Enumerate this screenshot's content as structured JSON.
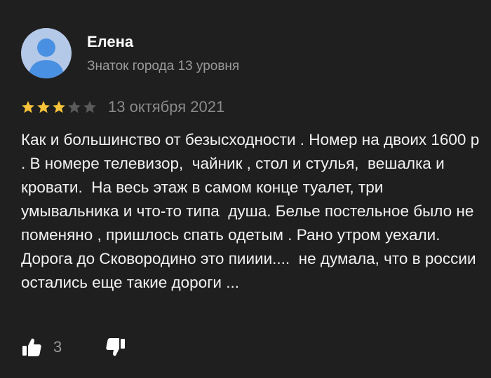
{
  "author": {
    "name": "Елена",
    "level": "Знаток города 13 уровня",
    "avatar_icon": "user-avatar-icon"
  },
  "rating": {
    "value": 3,
    "max": 5,
    "filled_color": "#f7c33b",
    "empty_color": "#5a5a5a"
  },
  "review": {
    "date": "13 октября 2021",
    "text": "Как и большинство от безысходности . Номер на двоих 1600 р . В номере телевизор,  чайник , стол и стулья,  вешалка и кровати.  На весь этаж в самом конце туалет, три умывальника и что-то типа  душа. Белье постельное было не поменяно , пришлось спать одетым . Рано утром уехали.\nДорога до Сковородино это пииии....  не думала, что в россии остались еще такие дороги ..."
  },
  "actions": {
    "likes": "3",
    "like_icon": "thumbs-up-icon",
    "dislike_icon": "thumbs-down-icon"
  },
  "colors": {
    "background": "#1f1f1f",
    "text": "#f2f2f2",
    "muted": "#9a9a9a",
    "avatar_bg": "#b4c8e8",
    "avatar_figure": "#4a90e2"
  }
}
